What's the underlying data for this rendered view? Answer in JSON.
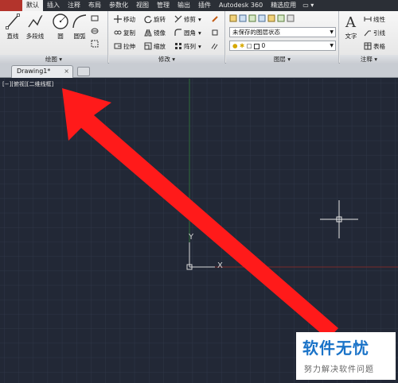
{
  "tabs": [
    "默认",
    "插入",
    "注释",
    "布局",
    "参数化",
    "视图",
    "管理",
    "输出",
    "插件",
    "Autodesk 360",
    "精选应用"
  ],
  "tab_dropdown": "▭ ▾",
  "draw": {
    "line": "直线",
    "polyline": "多段线",
    "circle": "圆",
    "arc": "圆弧",
    "title": "绘图"
  },
  "modify": {
    "move": "移动",
    "rotate": "旋转",
    "trim": "修剪",
    "copy": "复制",
    "mirror": "镜像",
    "fillet": "圆角",
    "stretch": "拉伸",
    "scale": "缩放",
    "array": "阵列",
    "title": "修改"
  },
  "layers": {
    "state": "未保存的图层状态",
    "current": "0",
    "title": "图层"
  },
  "annotation": {
    "text": "文字",
    "linear": "线性",
    "leader": "引线",
    "table": "表格",
    "title": "注释"
  },
  "document": {
    "tab": "Drawing1*",
    "close": "×"
  },
  "viewport": {
    "label": "[−][俯视][二维线框]",
    "ucs_y": "Y",
    "ucs_x": "X"
  },
  "watermark": {
    "title": "软件无忧",
    "subtitle": "努力解决软件问题"
  },
  "colors": {
    "accent_tab": "#f0f0f0",
    "canvas": "#222836",
    "annotation_arrow": "#ff1a1a",
    "watermark_text": "#1a73c8"
  }
}
